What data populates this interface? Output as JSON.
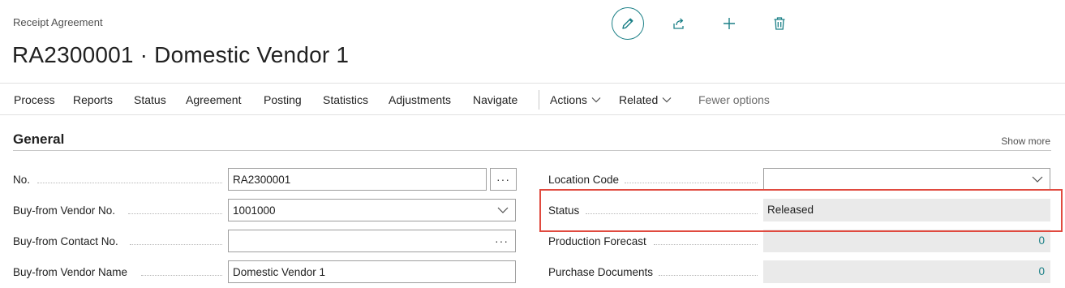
{
  "header": {
    "breadcrumb": "Receipt Agreement",
    "title": "RA2300001 · Domestic Vendor 1"
  },
  "toolbar": {
    "icons": [
      "edit-icon",
      "share-icon",
      "new-icon",
      "delete-icon"
    ]
  },
  "action_bar": {
    "items": [
      "Process",
      "Reports",
      "Status",
      "Agreement",
      "Posting",
      "Statistics",
      "Adjustments",
      "Navigate"
    ],
    "actions": "Actions",
    "related": "Related",
    "fewer": "Fewer options"
  },
  "section": {
    "title": "General",
    "show_more": "Show more"
  },
  "left_fields": {
    "no_label": "No.",
    "no_value": "RA2300001",
    "vendor_no_label": "Buy-from Vendor No.",
    "vendor_no_value": "1001000",
    "contact_no_label": "Buy-from Contact No.",
    "contact_no_value": "",
    "vendor_name_label": "Buy-from Vendor Name",
    "vendor_name_value": "Domestic Vendor 1"
  },
  "right_fields": {
    "location_label": "Location Code",
    "location_value": "",
    "status_label": "Status",
    "status_value": "Released",
    "forecast_label": "Production Forecast",
    "forecast_value": "0",
    "purchase_docs_label": "Purchase Documents",
    "purchase_docs_value": "0"
  },
  "colors": {
    "accent": "#1a7f86",
    "highlight": "#e04a3f"
  }
}
